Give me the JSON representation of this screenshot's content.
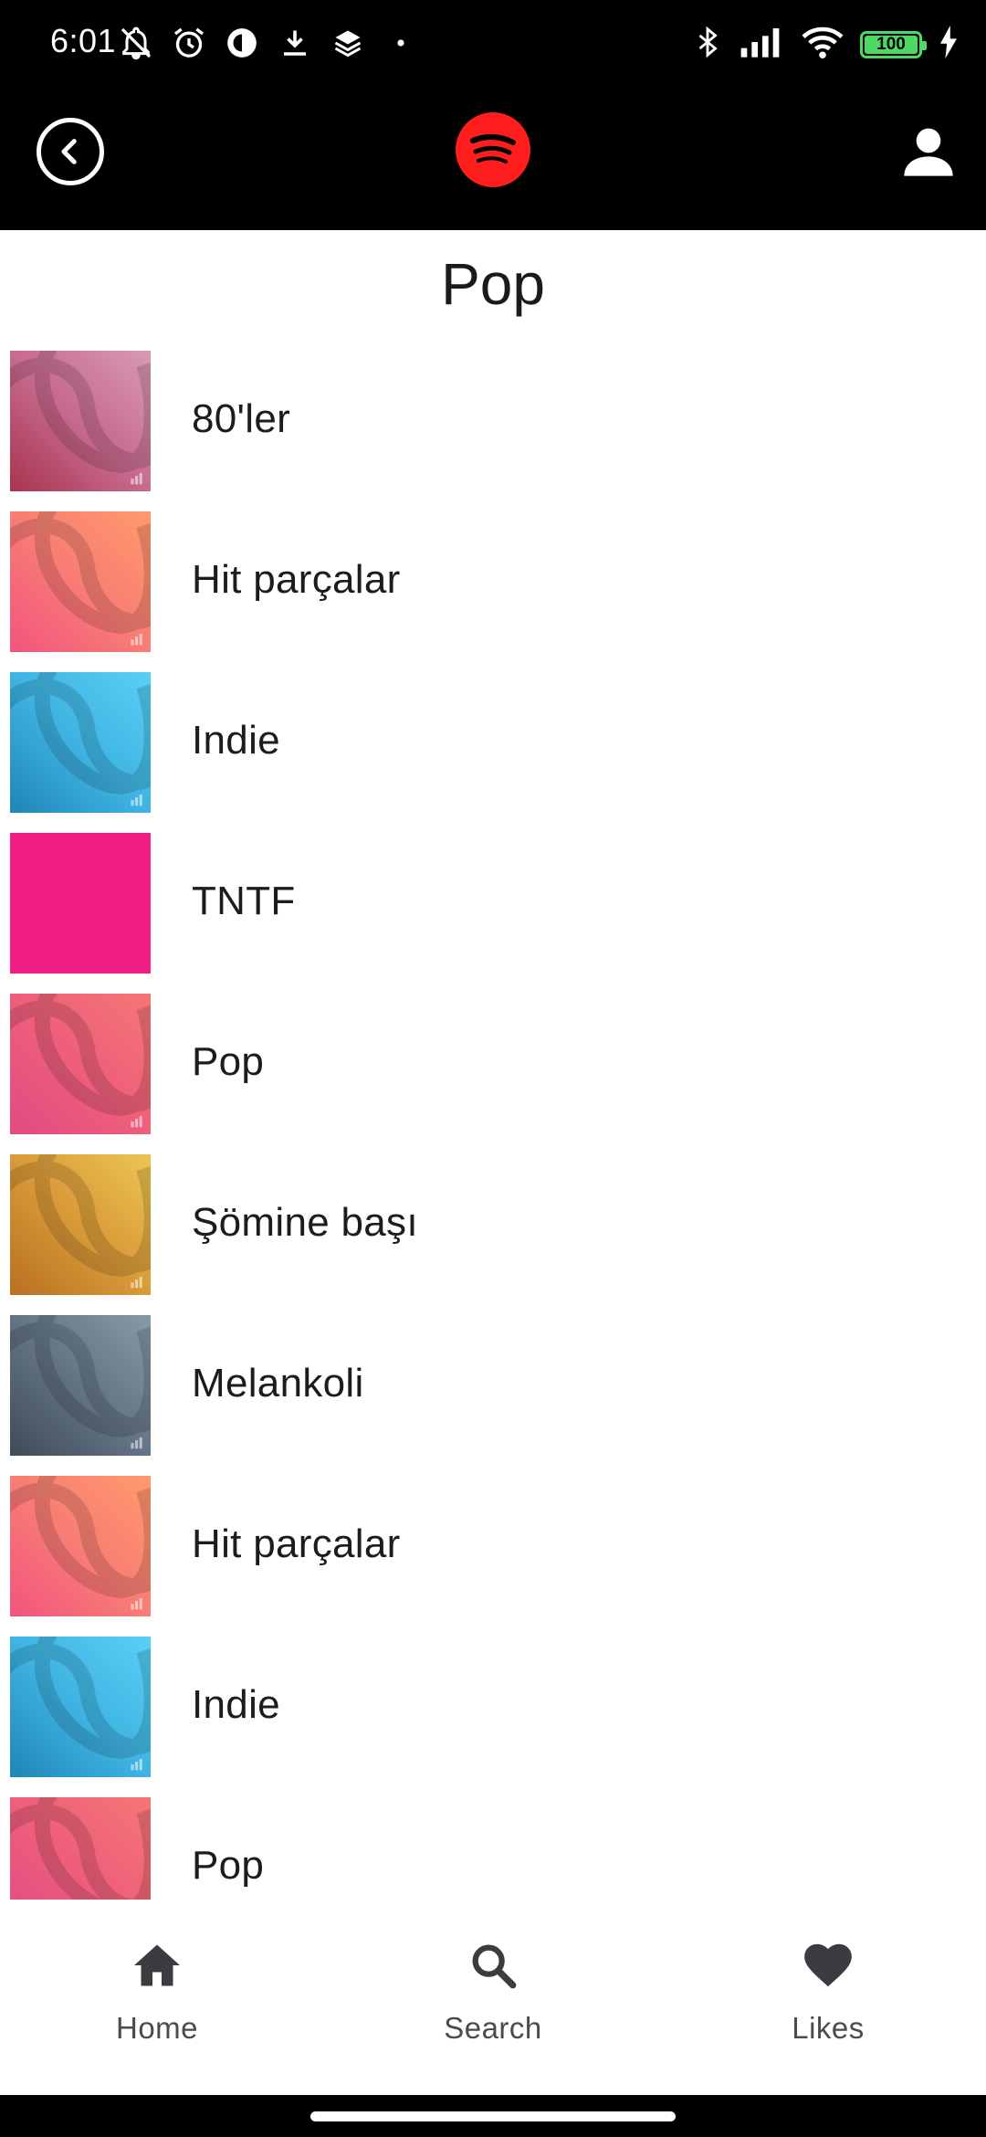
{
  "status_bar": {
    "time": "6:01",
    "battery": "100",
    "left_icons": [
      "mute-bell-icon",
      "alarm-icon",
      "circle-app-icon",
      "download-icon",
      "layers-icon",
      "dot-icon"
    ],
    "right_icons": [
      "bluetooth-icon",
      "signal-icon",
      "wifi-icon",
      "battery-icon",
      "charging-icon"
    ]
  },
  "header": {
    "back_icon": "back-arrow-circle-icon",
    "logo_icon": "spotify-logo-icon",
    "profile_icon": "person-icon",
    "logo_color": "#ff1e1e"
  },
  "page": {
    "title": "Pop"
  },
  "items": [
    {
      "label": "80'ler",
      "colors": [
        "#a8344f",
        "#c76b8e",
        "#d89ab6"
      ]
    },
    {
      "label": "Hit parçalar",
      "colors": [
        "#f2547e",
        "#f87d74",
        "#ff9a6b"
      ]
    },
    {
      "label": "Indie",
      "colors": [
        "#1f86b6",
        "#3fb4e2",
        "#58d0f6"
      ]
    },
    {
      "label": "TNTF",
      "colors": [
        "#f01e84",
        "#f01e84",
        "#f01e84"
      ]
    },
    {
      "label": "Pop",
      "colors": [
        "#e24a84",
        "#ee5f7a",
        "#f57676"
      ]
    },
    {
      "label": "Şömine başı",
      "colors": [
        "#b87022",
        "#d99a38",
        "#ebc552"
      ]
    },
    {
      "label": "Melankoli",
      "colors": [
        "#3f4b59",
        "#637484",
        "#879aa8"
      ]
    },
    {
      "label": "Hit parçalar",
      "colors": [
        "#f2547e",
        "#f87d74",
        "#ff9a6b"
      ]
    },
    {
      "label": "Indie",
      "colors": [
        "#1f86b6",
        "#3fb4e2",
        "#58d0f6"
      ]
    },
    {
      "label": "Pop",
      "colors": [
        "#e24a84",
        "#ee5f7a",
        "#f57676"
      ]
    }
  ],
  "nav": {
    "home": "Home",
    "search": "Search",
    "likes": "Likes"
  }
}
